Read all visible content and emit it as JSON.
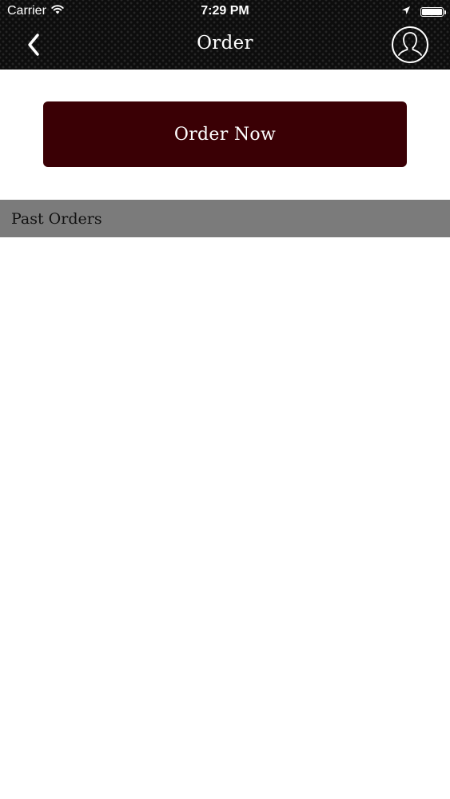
{
  "status_bar": {
    "carrier": "Carrier",
    "time": "7:29 PM",
    "battery_level": 1.0,
    "icons": [
      "wifi-icon",
      "location-arrow-icon",
      "battery-icon"
    ]
  },
  "nav": {
    "title": "Order",
    "back_icon": "chevron-left-icon",
    "profile_icon": "user-profile-icon"
  },
  "order_button": {
    "label": "Order Now",
    "color": "#3a0005"
  },
  "past_orders": {
    "header": "Past Orders",
    "header_color": "#7b7b7b",
    "items": []
  },
  "colors": {
    "nav_background": "#0d0d0d",
    "accent": "#3a0005"
  }
}
